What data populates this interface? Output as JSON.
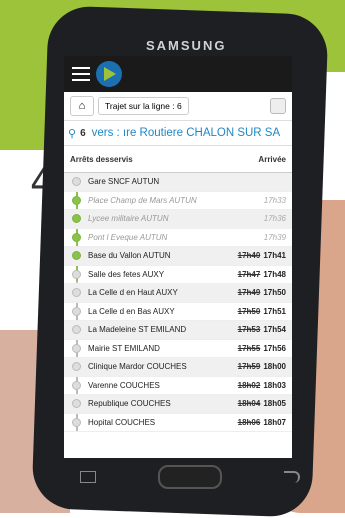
{
  "brand": "SAMSUNG",
  "background_text": "4",
  "app": {
    "breadcrumb": "Trajet sur la ligne : 6",
    "route_number": "6",
    "route_title": "vers : ıre Routiere CHALON SUR SA",
    "col_stops": "Arrêts desservis",
    "col_arrival": "Arrivée"
  },
  "stops": [
    {
      "name": "Gare SNCF AUTUN",
      "italic": false,
      "old": "",
      "new": "",
      "plain": "",
      "dot": "grey",
      "alt": true
    },
    {
      "name": "Place Champ de Mars AUTUN",
      "italic": true,
      "old": "",
      "new": "",
      "plain": "17h33",
      "dot": "green",
      "alt": false
    },
    {
      "name": "Lycee militaire AUTUN",
      "italic": true,
      "old": "",
      "new": "",
      "plain": "17h36",
      "dot": "green",
      "alt": true
    },
    {
      "name": "Pont l Eveque AUTUN",
      "italic": true,
      "old": "",
      "new": "",
      "plain": "17h39",
      "dot": "green",
      "alt": false
    },
    {
      "name": "Base du Vallon AUTUN",
      "italic": false,
      "old": "17h40",
      "new": "17h41",
      "plain": "",
      "dot": "green",
      "alt": true
    },
    {
      "name": "Salle des fetes AUXY",
      "italic": false,
      "old": "17h47",
      "new": "17h48",
      "plain": "",
      "dot": "grey",
      "alt": false
    },
    {
      "name": "La Celle d en Haut AUXY",
      "italic": false,
      "old": "17h49",
      "new": "17h50",
      "plain": "",
      "dot": "grey",
      "alt": true
    },
    {
      "name": "La Celle d en Bas AUXY",
      "italic": false,
      "old": "17h50",
      "new": "17h51",
      "plain": "",
      "dot": "grey",
      "alt": false
    },
    {
      "name": "La Madeleine ST EMILAND",
      "italic": false,
      "old": "17h53",
      "new": "17h54",
      "plain": "",
      "dot": "grey",
      "alt": true
    },
    {
      "name": "Mairie ST EMILAND",
      "italic": false,
      "old": "17h55",
      "new": "17h56",
      "plain": "",
      "dot": "grey",
      "alt": false
    },
    {
      "name": "Clinique Mardor COUCHES",
      "italic": false,
      "old": "17h59",
      "new": "18h00",
      "plain": "",
      "dot": "grey",
      "alt": true
    },
    {
      "name": "Varenne COUCHES",
      "italic": false,
      "old": "18h02",
      "new": "18h03",
      "plain": "",
      "dot": "grey",
      "alt": false
    },
    {
      "name": "Republique COUCHES",
      "italic": false,
      "old": "18h04",
      "new": "18h05",
      "plain": "",
      "dot": "grey",
      "alt": true
    },
    {
      "name": "Hopital COUCHES",
      "italic": false,
      "old": "18h06",
      "new": "18h07",
      "plain": "",
      "dot": "grey",
      "alt": false
    }
  ]
}
